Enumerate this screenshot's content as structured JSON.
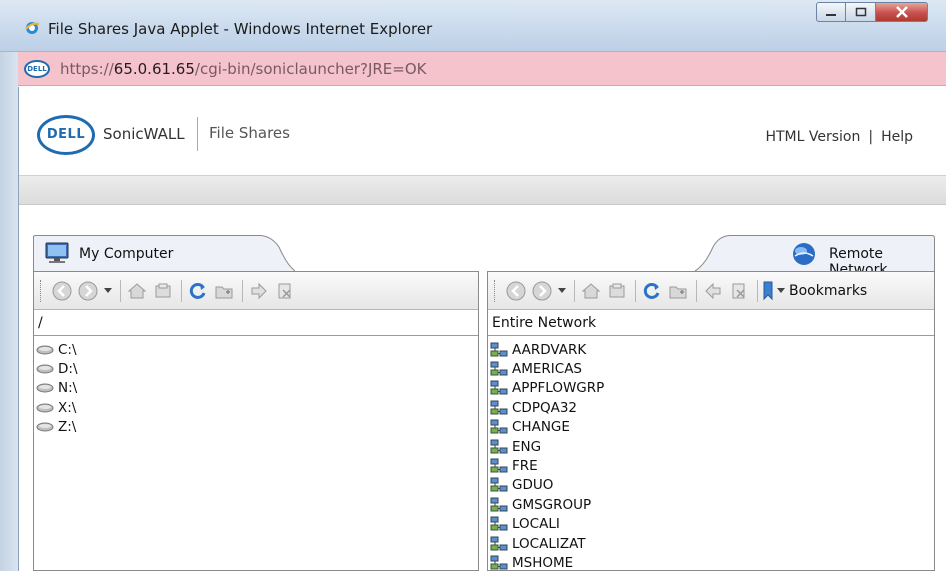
{
  "window": {
    "title": "File Shares Java Applet - Windows Internet Explorer",
    "controls": [
      "minimize",
      "maximize",
      "close"
    ]
  },
  "address": {
    "url_prefix": "https://",
    "url_host": "65.0.61.65",
    "url_path": "/cgi-bin/soniclauncher?JRE=OK",
    "site_icon": "DELL"
  },
  "header": {
    "logo_text": "DELL",
    "brand": "SonicWALL",
    "app_name": "File Shares",
    "links": [
      "HTML Version",
      "Help"
    ],
    "links_separator": "|"
  },
  "left_pane": {
    "tab_label": "My Computer",
    "path": "/",
    "items": [
      "C:\\",
      "D:\\",
      "N:\\",
      "X:\\",
      "Z:\\"
    ]
  },
  "right_pane": {
    "tab_label": "Remote Network",
    "path": "Entire Network",
    "bookmarks_label": "Bookmarks",
    "items": [
      "AARDVARK",
      "AMERICAS",
      "APPFLOWGRP",
      "CDPQA32",
      "CHANGE",
      "ENG",
      "FRE",
      "GDUO",
      "GMSGROUP",
      "LOCALI",
      "LOCALIZAT",
      "MSHOME"
    ]
  },
  "colors": {
    "address_bar": "#f4c3cc",
    "dell_blue": "#1e6bb0",
    "tab_fill": "#eef2f8"
  }
}
